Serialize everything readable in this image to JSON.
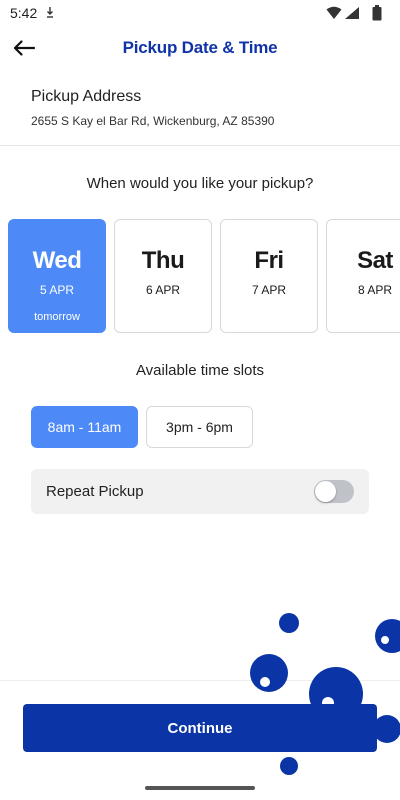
{
  "status_bar": {
    "time": "5:42"
  },
  "header": {
    "title": "Pickup Date & Time"
  },
  "address": {
    "label": "Pickup Address",
    "value": "2655 S Kay el Bar Rd, Wickenburg, AZ 85390"
  },
  "date_prompt": "When would you like your pickup?",
  "dates": [
    {
      "day": "Wed",
      "date": "5 APR",
      "note": "tomorrow",
      "selected": true
    },
    {
      "day": "Thu",
      "date": "6 APR",
      "note": "",
      "selected": false
    },
    {
      "day": "Fri",
      "date": "7 APR",
      "note": "",
      "selected": false
    },
    {
      "day": "Sat",
      "date": "8 APR",
      "note": "",
      "selected": false
    }
  ],
  "slots_heading": "Available time slots",
  "slots": [
    {
      "label": "8am - 11am",
      "selected": true
    },
    {
      "label": "3pm - 6pm",
      "selected": false
    }
  ],
  "repeat": {
    "label": "Repeat Pickup",
    "enabled": false
  },
  "continue_label": "Continue",
  "colors": {
    "brand": "#1133aa",
    "button": "#0b35a6",
    "selected": "#4d8af8",
    "decoration": "#0b35a6"
  }
}
